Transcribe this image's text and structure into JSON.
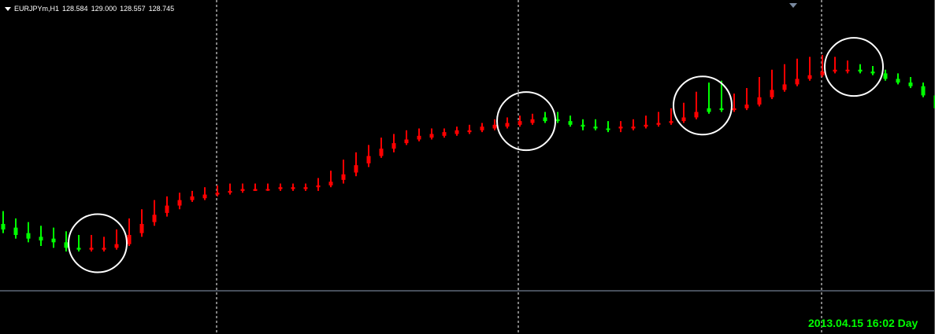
{
  "header": {
    "symbol": "EURJPYm,H1",
    "open": "128.584",
    "high": "129.000",
    "low": "128.557",
    "close": "128.745"
  },
  "timestamp": "2013.04.15 16:02 Day",
  "colors": {
    "background": "#000000",
    "bull": "#00ff00",
    "bear": "#ff0000",
    "grid": "#ffffff",
    "separator": "#8c9cb4",
    "timestamp": "#00ff00",
    "circle": "#ffffff"
  },
  "chart_data": {
    "type": "candlestick",
    "title": "",
    "xlabel": "",
    "ylabel": "",
    "grid": "vertical-dashed",
    "ylim": [
      0,
      100
    ],
    "series": [
      {
        "values": [
          {
            "o": 35,
            "h": 42,
            "l": 30,
            "c": 32,
            "bull": true
          },
          {
            "o": 33,
            "h": 38,
            "l": 27,
            "c": 29,
            "bull": true
          },
          {
            "o": 30,
            "h": 36,
            "l": 25,
            "c": 27,
            "bull": true
          },
          {
            "o": 28,
            "h": 34,
            "l": 23,
            "c": 26,
            "bull": true
          },
          {
            "o": 27,
            "h": 33,
            "l": 22,
            "c": 25,
            "bull": true
          },
          {
            "o": 25,
            "h": 31,
            "l": 20,
            "c": 22,
            "bull": true
          },
          {
            "o": 22,
            "h": 29,
            "l": 20,
            "c": 21,
            "bull": true
          },
          {
            "o": 22,
            "h": 29,
            "l": 20,
            "c": 21,
            "bull": false
          },
          {
            "o": 21,
            "h": 28,
            "l": 20,
            "c": 22,
            "bull": false
          },
          {
            "o": 22,
            "h": 32,
            "l": 21,
            "c": 24,
            "bull": false
          },
          {
            "o": 24,
            "h": 38,
            "l": 23,
            "c": 29,
            "bull": false
          },
          {
            "o": 30,
            "h": 43,
            "l": 28,
            "c": 35,
            "bull": false
          },
          {
            "o": 36,
            "h": 48,
            "l": 34,
            "c": 40,
            "bull": false
          },
          {
            "o": 41,
            "h": 50,
            "l": 39,
            "c": 45,
            "bull": false
          },
          {
            "o": 45,
            "h": 52,
            "l": 43,
            "c": 48,
            "bull": false
          },
          {
            "o": 48,
            "h": 53,
            "l": 47,
            "c": 50,
            "bull": false
          },
          {
            "o": 49,
            "h": 55,
            "l": 48,
            "c": 51,
            "bull": false
          },
          {
            "o": 51,
            "h": 56,
            "l": 50,
            "c": 52,
            "bull": false
          },
          {
            "o": 52,
            "h": 57,
            "l": 51,
            "c": 53,
            "bull": false
          },
          {
            "o": 53,
            "h": 57,
            "l": 52,
            "c": 54,
            "bull": false
          },
          {
            "o": 53,
            "h": 57,
            "l": 53,
            "c": 54,
            "bull": false
          },
          {
            "o": 54,
            "h": 57,
            "l": 53,
            "c": 54,
            "bull": false
          },
          {
            "o": 54,
            "h": 57,
            "l": 53,
            "c": 55,
            "bull": false
          },
          {
            "o": 54,
            "h": 57,
            "l": 53,
            "c": 55,
            "bull": false
          },
          {
            "o": 54,
            "h": 57,
            "l": 53,
            "c": 55,
            "bull": false
          },
          {
            "o": 55,
            "h": 60,
            "l": 53,
            "c": 56,
            "bull": false
          },
          {
            "o": 56,
            "h": 64,
            "l": 55,
            "c": 58,
            "bull": false
          },
          {
            "o": 59,
            "h": 70,
            "l": 57,
            "c": 62,
            "bull": false
          },
          {
            "o": 63,
            "h": 74,
            "l": 61,
            "c": 67,
            "bull": false
          },
          {
            "o": 68,
            "h": 78,
            "l": 66,
            "c": 72,
            "bull": false
          },
          {
            "o": 72,
            "h": 82,
            "l": 71,
            "c": 76,
            "bull": false
          },
          {
            "o": 76,
            "h": 84,
            "l": 74,
            "c": 79,
            "bull": false
          },
          {
            "o": 79,
            "h": 86,
            "l": 78,
            "c": 81,
            "bull": false
          },
          {
            "o": 81,
            "h": 87,
            "l": 80,
            "c": 83,
            "bull": false
          },
          {
            "o": 82,
            "h": 87,
            "l": 81,
            "c": 84,
            "bull": false
          },
          {
            "o": 83,
            "h": 87,
            "l": 82,
            "c": 85,
            "bull": false
          },
          {
            "o": 84,
            "h": 88,
            "l": 83,
            "c": 86,
            "bull": false
          },
          {
            "o": 85,
            "h": 89,
            "l": 84,
            "c": 86,
            "bull": false
          },
          {
            "o": 86,
            "h": 90,
            "l": 85,
            "c": 88,
            "bull": false
          },
          {
            "o": 87,
            "h": 92,
            "l": 86,
            "c": 89,
            "bull": false
          },
          {
            "o": 88,
            "h": 93,
            "l": 87,
            "c": 90,
            "bull": false
          },
          {
            "o": 89,
            "h": 94,
            "l": 88,
            "c": 91,
            "bull": false
          },
          {
            "o": 90,
            "h": 95,
            "l": 89,
            "c": 92,
            "bull": false
          },
          {
            "o": 91,
            "h": 96,
            "l": 90,
            "c": 93,
            "bull": true
          },
          {
            "o": 92,
            "h": 96,
            "l": 90,
            "c": 91,
            "bull": true
          },
          {
            "o": 91,
            "h": 94,
            "l": 88,
            "c": 89,
            "bull": true
          },
          {
            "o": 89,
            "h": 92,
            "l": 86,
            "c": 88,
            "bull": true
          },
          {
            "o": 88,
            "h": 92,
            "l": 86,
            "c": 87,
            "bull": true
          },
          {
            "o": 87,
            "h": 91,
            "l": 85,
            "c": 87,
            "bull": true
          },
          {
            "o": 87,
            "h": 91,
            "l": 85,
            "c": 88,
            "bull": false
          },
          {
            "o": 87,
            "h": 92,
            "l": 86,
            "c": 88,
            "bull": false
          },
          {
            "o": 88,
            "h": 94,
            "l": 87,
            "c": 89,
            "bull": false
          },
          {
            "o": 89,
            "h": 96,
            "l": 88,
            "c": 90,
            "bull": false
          },
          {
            "o": 90,
            "h": 98,
            "l": 89,
            "c": 91,
            "bull": false
          },
          {
            "o": 91,
            "h": 101,
            "l": 90,
            "c": 93,
            "bull": false
          },
          {
            "o": 93,
            "h": 107,
            "l": 92,
            "c": 96,
            "bull": false
          },
          {
            "o": 96,
            "h": 112,
            "l": 95,
            "c": 98,
            "bull": true
          },
          {
            "o": 98,
            "h": 113,
            "l": 96,
            "c": 97,
            "bull": true
          },
          {
            "o": 97,
            "h": 106,
            "l": 96,
            "c": 98,
            "bull": false
          },
          {
            "o": 98,
            "h": 109,
            "l": 97,
            "c": 100,
            "bull": false
          },
          {
            "o": 100,
            "h": 115,
            "l": 99,
            "c": 104,
            "bull": false
          },
          {
            "o": 104,
            "h": 119,
            "l": 103,
            "c": 108,
            "bull": false
          },
          {
            "o": 108,
            "h": 122,
            "l": 107,
            "c": 111,
            "bull": false
          },
          {
            "o": 111,
            "h": 125,
            "l": 110,
            "c": 114,
            "bull": false
          },
          {
            "o": 114,
            "h": 126,
            "l": 113,
            "c": 116,
            "bull": false
          },
          {
            "o": 116,
            "h": 127,
            "l": 115,
            "c": 118,
            "bull": false
          },
          {
            "o": 118,
            "h": 126,
            "l": 117,
            "c": 119,
            "bull": false
          },
          {
            "o": 119,
            "h": 124,
            "l": 117,
            "c": 119,
            "bull": false
          },
          {
            "o": 119,
            "h": 122,
            "l": 117,
            "c": 118,
            "bull": true
          },
          {
            "o": 118,
            "h": 121,
            "l": 116,
            "c": 117,
            "bull": true
          },
          {
            "o": 117,
            "h": 119,
            "l": 113,
            "c": 114,
            "bull": true
          },
          {
            "o": 114,
            "h": 117,
            "l": 111,
            "c": 112,
            "bull": true
          },
          {
            "o": 112,
            "h": 115,
            "l": 109,
            "c": 110,
            "bull": true
          },
          {
            "o": 110,
            "h": 112,
            "l": 104,
            "c": 105,
            "bull": true
          },
          {
            "o": 105,
            "h": 108,
            "l": 96,
            "c": 98,
            "bull": true
          }
        ]
      }
    ],
    "annotations": [
      {
        "type": "circle",
        "at_bar": 7
      },
      {
        "type": "circle",
        "at_bar": 41
      },
      {
        "type": "circle",
        "at_bar": 55
      },
      {
        "type": "circle",
        "at_bar": 67
      }
    ]
  }
}
